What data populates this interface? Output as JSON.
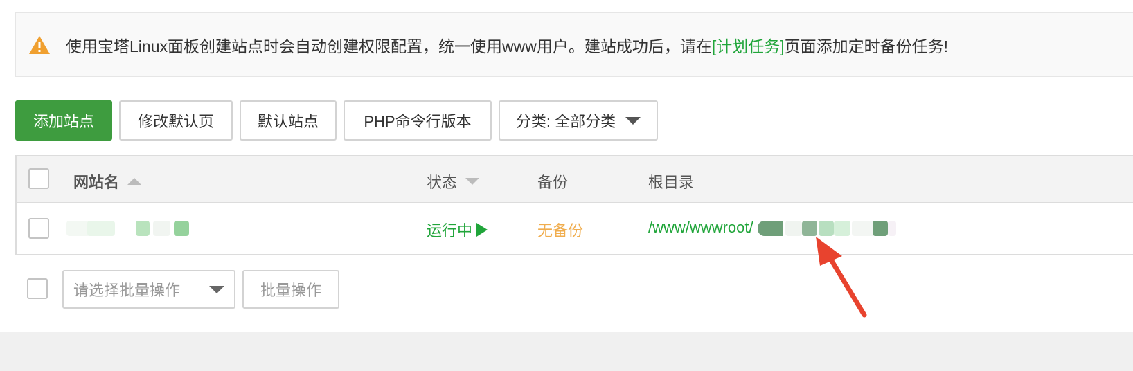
{
  "notice": {
    "text_before": "使用宝塔Linux面板创建站点时会自动创建权限配置，统一使用www用户。建站成功后，请在",
    "link_text": "[计划任务]",
    "text_after": "页面添加定时备份任务!",
    "icon": "warning-icon"
  },
  "toolbar": {
    "add_site": "添加站点",
    "edit_default_page": "修改默认页",
    "default_site": "默认站点",
    "php_cli_version": "PHP命令行版本",
    "category_select": "分类: 全部分类"
  },
  "table": {
    "headers": {
      "site_name": "网站名",
      "status": "状态",
      "backup": "备份",
      "root_dir": "根目录"
    },
    "rows": [
      {
        "site_name": "",
        "status": "运行中",
        "backup": "无备份",
        "root_dir": "/www/wwwroot/"
      }
    ]
  },
  "batch": {
    "select_placeholder": "请选择批量操作",
    "button": "批量操作"
  },
  "colors": {
    "primary_green": "#3e9c3f",
    "link_green": "#20a53a",
    "warning_orange": "#f0ad4e",
    "annotation_red": "#e8432e"
  }
}
